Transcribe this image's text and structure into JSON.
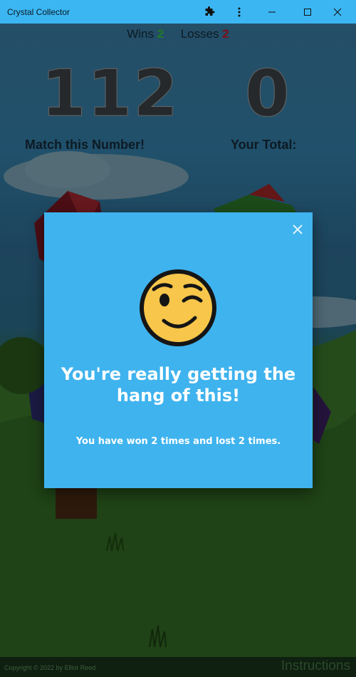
{
  "window": {
    "title": "Crystal Collector",
    "icons": [
      "puzzle-icon",
      "more-icon",
      "minimize-icon",
      "maximize-icon",
      "close-icon"
    ]
  },
  "scoreboard": {
    "wins_label": "Wins",
    "wins_value": "2",
    "losses_label": "Losses",
    "losses_value": "2"
  },
  "game": {
    "target_number": "112",
    "target_label": "Match this Number!",
    "total_number": "0",
    "total_label": "Your Total:"
  },
  "footer": {
    "copyright": "Copyright © 2022 by Elliot Reed",
    "instructions": "Instructions"
  },
  "modal": {
    "emoji": "winking-face-icon",
    "heading": "You're really getting the hang of this!",
    "message": "You have won 2 times and lost 2 times.",
    "close_icon": "close-icon"
  },
  "colors": {
    "titlebar": "#3bb6f2",
    "modal_bg": "#3fb3ee",
    "wins": "#1f7a24",
    "losses": "#7a0f18"
  }
}
